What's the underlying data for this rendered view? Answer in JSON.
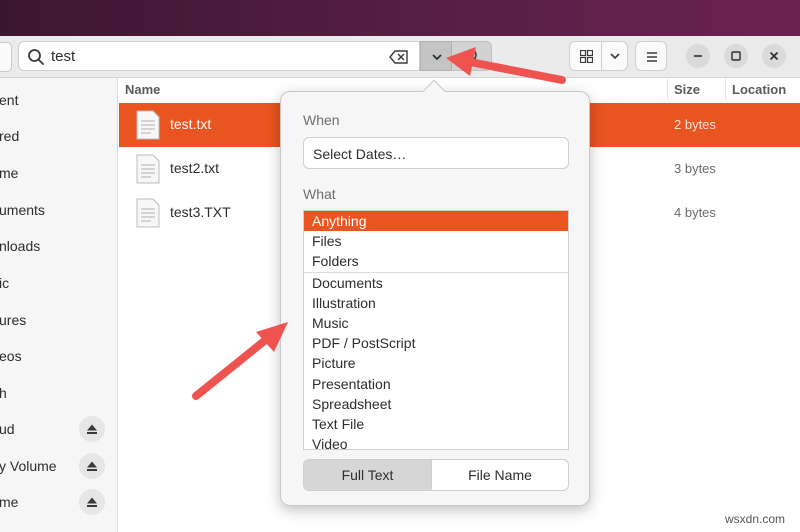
{
  "search": {
    "query": "test"
  },
  "sidebar": {
    "items": [
      {
        "label": "ent"
      },
      {
        "label": "red"
      },
      {
        "label": "me"
      },
      {
        "label": "uments"
      },
      {
        "label": "nloads"
      },
      {
        "label": "ic"
      },
      {
        "label": "ures"
      },
      {
        "label": "eos"
      },
      {
        "label": "h"
      },
      {
        "label": "ud"
      },
      {
        "label": "y Volume"
      },
      {
        "label": "me"
      }
    ]
  },
  "columns": {
    "name": "Name",
    "size": "Size",
    "location": "Location"
  },
  "files": [
    {
      "name": "test.txt",
      "size": "2 bytes"
    },
    {
      "name": "test2.txt",
      "size": "3 bytes"
    },
    {
      "name": "test3.TXT",
      "size": "4 bytes"
    }
  ],
  "popover": {
    "when_label": "When",
    "dates_button": "Select Dates…",
    "what_label": "What",
    "types": [
      "Anything",
      "Files",
      "Folders",
      "Documents",
      "Illustration",
      "Music",
      "PDF / PostScript",
      "Picture",
      "Presentation",
      "Spreadsheet",
      "Text File",
      "Video"
    ],
    "full_text": "Full Text",
    "file_name": "File Name"
  },
  "watermark": "wsxdn.com",
  "colors": {
    "accent": "#e95420",
    "annotation_arrow": "#ef5350"
  },
  "icons": [
    "search-icon",
    "clear-icon",
    "chevron-down-icon",
    "search-toggle-icon",
    "grid-view-icon",
    "hamburger-menu-icon",
    "minimize-icon",
    "maximize-icon",
    "close-icon",
    "eject-icon",
    "text-file-icon"
  ]
}
